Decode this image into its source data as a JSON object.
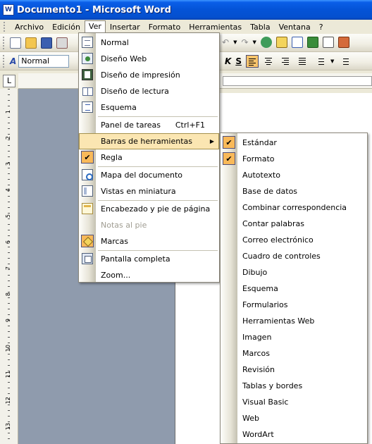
{
  "window": {
    "title": "Documento1 - Microsoft Word",
    "app_icon": "W"
  },
  "menubar": {
    "items": [
      "Archivo",
      "Edición",
      "Ver",
      "Insertar",
      "Formato",
      "Herramientas",
      "Tabla",
      "Ventana",
      "?"
    ]
  },
  "toolbar": {
    "style_value": "Normal",
    "style_icon": "A",
    "bold_label": "K",
    "strike_label": "S"
  },
  "colors": {
    "titlebar": "#0453d6",
    "highlight": "#fbe6b2",
    "check": "#f9b959",
    "gray_area": "#8f9bad"
  },
  "ver_menu": {
    "items": [
      {
        "label": "Normal",
        "icon": "normal-view-icon"
      },
      {
        "label": "Diseño Web",
        "icon": "web-layout-icon"
      },
      {
        "label": "Diseño de impresión",
        "icon": "print-layout-icon"
      },
      {
        "label": "Diseño de lectura",
        "icon": "reading-layout-icon"
      },
      {
        "label": "Esquema",
        "icon": "outline-view-icon"
      },
      {
        "label": "Panel de tareas",
        "shortcut": "Ctrl+F1"
      },
      {
        "label": "Barras de herramientas",
        "submenu": true
      },
      {
        "label": "Regla",
        "checked": true
      },
      {
        "label": "Mapa del documento",
        "icon": "document-map-icon"
      },
      {
        "label": "Vistas en miniatura",
        "icon": "thumbnails-icon"
      },
      {
        "label": "Encabezado y pie de página",
        "icon": "header-footer-icon"
      },
      {
        "label": "Notas al pie",
        "disabled": true
      },
      {
        "label": "Marcas",
        "icon": "markup-icon"
      },
      {
        "label": "Pantalla completa",
        "icon": "full-screen-icon"
      },
      {
        "label": "Zoom..."
      }
    ]
  },
  "toolbars_submenu": {
    "items": [
      {
        "label": "Estándar",
        "checked": true
      },
      {
        "label": "Formato",
        "checked": true
      },
      {
        "label": "Autotexto"
      },
      {
        "label": "Base de datos"
      },
      {
        "label": "Combinar correspondencia"
      },
      {
        "label": "Contar palabras"
      },
      {
        "label": "Correo electrónico"
      },
      {
        "label": "Cuadro de controles"
      },
      {
        "label": "Dibujo"
      },
      {
        "label": "Esquema"
      },
      {
        "label": "Formularios"
      },
      {
        "label": "Herramientas Web"
      },
      {
        "label": "Imagen"
      },
      {
        "label": "Marcos"
      },
      {
        "label": "Revisión"
      },
      {
        "label": "Tablas y bordes"
      },
      {
        "label": "Visual Basic"
      },
      {
        "label": "Web"
      },
      {
        "label": "WordArt"
      }
    ]
  },
  "vruler": {
    "labels": [
      "1",
      "2",
      "3",
      "4",
      "5",
      "6",
      "7",
      "8",
      "9",
      "10",
      "11",
      "12",
      "13"
    ]
  }
}
